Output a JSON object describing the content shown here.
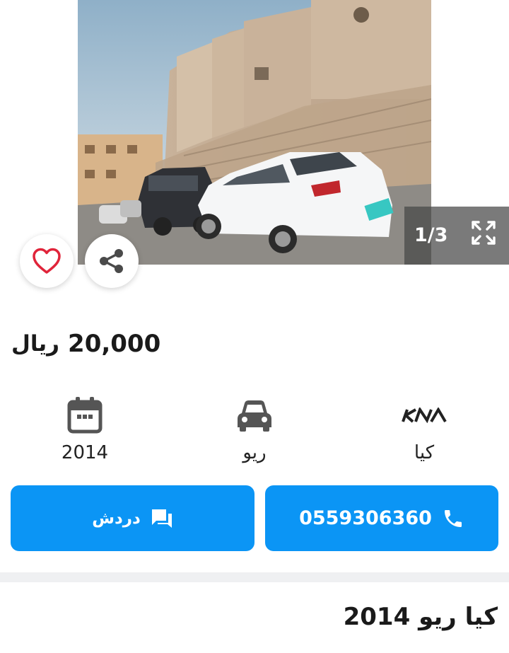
{
  "gallery": {
    "counter": "1/3",
    "prev_icon": "chevron-left-icon",
    "next_icon": "chevron-right-icon",
    "fullscreen_icon": "fullscreen-icon"
  },
  "actions": {
    "favorite_icon": "heart-icon",
    "share_icon": "share-icon"
  },
  "listing": {
    "price_amount": "20,000",
    "price_currency": "ريال",
    "title": "كيا ريو 2014"
  },
  "specs": {
    "year": "2014",
    "model": "ريو",
    "brand": "كيا",
    "year_icon": "calendar-icon",
    "model_icon": "car-icon",
    "brand_icon": "kia-logo"
  },
  "buttons": {
    "chat_label": "دردش",
    "phone_label": "0559306360",
    "chat_icon": "chat-icon",
    "phone_icon": "phone-icon"
  },
  "colors": {
    "accent": "#0b95f5",
    "favorite": "#e0243a"
  }
}
